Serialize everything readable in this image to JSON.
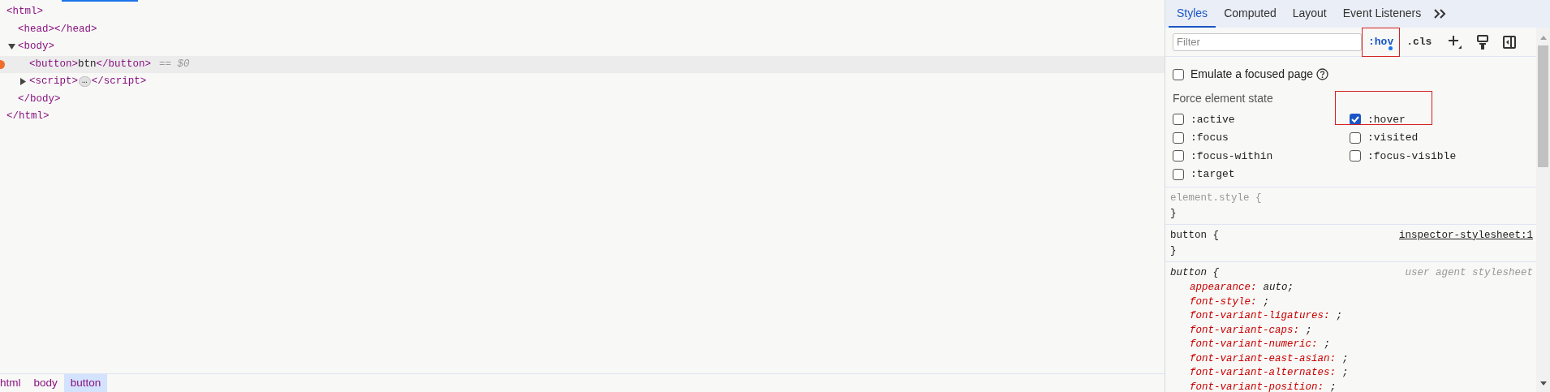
{
  "dom_tree": [
    {
      "open": "<html>",
      "close": "</html>",
      "children": [
        {
          "open": "<head></head>"
        },
        {
          "open": "<body>",
          "close": "</body>",
          "expanded": true,
          "children": [
            {
              "open": "<button>",
              "content": "btn",
              "close_inline": "</button>",
              "selected": true,
              "note": "== $0"
            },
            {
              "open": "<script>",
              "badge": "…",
              "close_inline": "</script>",
              "expanded": false
            }
          ]
        }
      ]
    }
  ],
  "breadcrumbs": [
    {
      "label": "html",
      "selected": false
    },
    {
      "label": "body",
      "selected": false
    },
    {
      "label": "button",
      "selected": true
    }
  ],
  "styles_pane": {
    "tabs": [
      {
        "label": "Styles",
        "selected": true
      },
      {
        "label": "Computed",
        "selected": false
      },
      {
        "label": "Layout",
        "selected": false
      },
      {
        "label": "Event Listeners",
        "selected": false
      }
    ],
    "filter": {
      "placeholder": "Filter"
    },
    "toggles": [
      {
        "label": ":hov",
        "active": true,
        "highlighted": true
      },
      {
        "label": ".cls",
        "active": false,
        "highlighted": false
      }
    ],
    "emulate_focus": {
      "label": "Emulate a focused page",
      "checked": false
    },
    "force_state": {
      "title": "Force element state",
      "states": [
        {
          "label": ":active",
          "checked": false,
          "highlighted": false
        },
        {
          "label": ":hover",
          "checked": true,
          "highlighted": true
        },
        {
          "label": ":focus",
          "checked": false,
          "highlighted": false
        },
        {
          "label": ":visited",
          "checked": false,
          "highlighted": false
        },
        {
          "label": ":focus-within",
          "checked": false,
          "highlighted": false
        },
        {
          "label": ":focus-visible",
          "checked": false,
          "highlighted": false
        },
        {
          "label": ":target",
          "checked": false,
          "highlighted": false
        }
      ]
    },
    "rules": [
      {
        "kind": "inline",
        "selector": "element.style {",
        "close": "}"
      },
      {
        "kind": "author",
        "selector": "button {",
        "source": "inspector-stylesheet:1",
        "close": "}"
      },
      {
        "kind": "user_agent",
        "selector": "button {",
        "source": "user agent stylesheet",
        "declarations": [
          {
            "property": "appearance:",
            "value": "auto;"
          },
          {
            "property": "font-style:",
            "value": ";"
          },
          {
            "property": "font-variant-ligatures:",
            "value": ";"
          },
          {
            "property": "font-variant-caps:",
            "value": ";"
          },
          {
            "property": "font-variant-numeric:",
            "value": ";"
          },
          {
            "property": "font-variant-east-asian:",
            "value": ";"
          },
          {
            "property": "font-variant-alternates:",
            "value": ";"
          },
          {
            "property": "font-variant-position:",
            "value": ";"
          }
        ]
      }
    ]
  }
}
